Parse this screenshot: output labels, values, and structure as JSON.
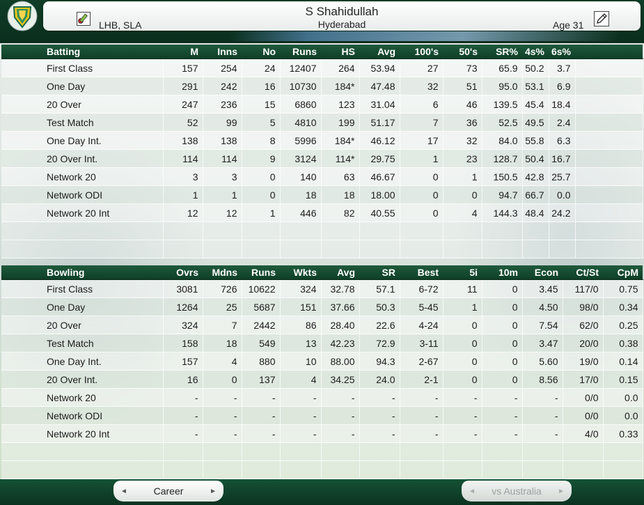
{
  "header": {
    "name": "S Shahidullah",
    "team": "Hyderabad",
    "style": "LHB, SLA",
    "age": "Age 31"
  },
  "batting": {
    "columns": [
      "Batting",
      "M",
      "Inns",
      "No",
      "Runs",
      "HS",
      "Avg",
      "100's",
      "50's",
      "SR%",
      "4s%",
      "6s%"
    ],
    "rows": [
      [
        "First Class",
        "157",
        "254",
        "24",
        "12407",
        "264",
        "53.94",
        "27",
        "73",
        "65.9",
        "50.2",
        "3.7"
      ],
      [
        "One Day",
        "291",
        "242",
        "16",
        "10730",
        "184*",
        "47.48",
        "32",
        "51",
        "95.0",
        "53.1",
        "6.9"
      ],
      [
        "20 Over",
        "247",
        "236",
        "15",
        "6860",
        "123",
        "31.04",
        "6",
        "46",
        "139.5",
        "45.4",
        "18.4"
      ],
      [
        "Test Match",
        "52",
        "99",
        "5",
        "4810",
        "199",
        "51.17",
        "7",
        "36",
        "52.5",
        "49.5",
        "2.4"
      ],
      [
        "One Day Int.",
        "138",
        "138",
        "8",
        "5996",
        "184*",
        "46.12",
        "17",
        "32",
        "84.0",
        "55.8",
        "6.3"
      ],
      [
        "20 Over Int.",
        "114",
        "114",
        "9",
        "3124",
        "114*",
        "29.75",
        "1",
        "23",
        "128.7",
        "50.4",
        "16.7"
      ],
      [
        "Network 20",
        "3",
        "3",
        "0",
        "140",
        "63",
        "46.67",
        "0",
        "1",
        "150.5",
        "42.8",
        "25.7"
      ],
      [
        "Network ODI",
        "1",
        "1",
        "0",
        "18",
        "18",
        "18.00",
        "0",
        "0",
        "94.7",
        "66.7",
        "0.0"
      ],
      [
        "Network 20 Int",
        "12",
        "12",
        "1",
        "446",
        "82",
        "40.55",
        "0",
        "4",
        "144.3",
        "48.4",
        "24.2"
      ]
    ]
  },
  "bowling": {
    "columns": [
      "Bowling",
      "Ovrs",
      "Mdns",
      "Runs",
      "Wkts",
      "Avg",
      "SR",
      "Best",
      "5i",
      "10m",
      "Econ",
      "Ct/St",
      "CpM"
    ],
    "rows": [
      [
        "First Class",
        "3081",
        "726",
        "10622",
        "324",
        "32.78",
        "57.1",
        "6-72",
        "11",
        "0",
        "3.45",
        "117/0",
        "0.75"
      ],
      [
        "One Day",
        "1264",
        "25",
        "5687",
        "151",
        "37.66",
        "50.3",
        "5-45",
        "1",
        "0",
        "4.50",
        "98/0",
        "0.34"
      ],
      [
        "20 Over",
        "324",
        "7",
        "2442",
        "86",
        "28.40",
        "22.6",
        "4-24",
        "0",
        "0",
        "7.54",
        "62/0",
        "0.25"
      ],
      [
        "Test Match",
        "158",
        "18",
        "549",
        "13",
        "42.23",
        "72.9",
        "3-11",
        "0",
        "0",
        "3.47",
        "20/0",
        "0.38"
      ],
      [
        "One Day Int.",
        "157",
        "4",
        "880",
        "10",
        "88.00",
        "94.3",
        "2-67",
        "0",
        "0",
        "5.60",
        "19/0",
        "0.14"
      ],
      [
        "20 Over Int.",
        "16",
        "0",
        "137",
        "4",
        "34.25",
        "24.0",
        "2-1",
        "0",
        "0",
        "8.56",
        "17/0",
        "0.15"
      ],
      [
        "Network 20",
        "-",
        "-",
        "-",
        "-",
        "-",
        "-",
        "-",
        "-",
        "-",
        "-",
        "0/0",
        "0.0"
      ],
      [
        "Network ODI",
        "-",
        "-",
        "-",
        "-",
        "-",
        "-",
        "-",
        "-",
        "-",
        "-",
        "0/0",
        "0.0"
      ],
      [
        "Network 20 Int",
        "-",
        "-",
        "-",
        "-",
        "-",
        "-",
        "-",
        "-",
        "-",
        "-",
        "4/0",
        "0.33"
      ]
    ]
  },
  "footer": {
    "left_tab": "Career",
    "right_tab": "vs Australia",
    "arrow_left": "◄",
    "arrow_right": "►"
  },
  "icons": {
    "crest": "shield-icon",
    "style": "bat-ball-icon",
    "edit": "pencil-icon"
  },
  "colors": {
    "header_green": "#0f3d27",
    "row_light": "#ffffff"
  }
}
